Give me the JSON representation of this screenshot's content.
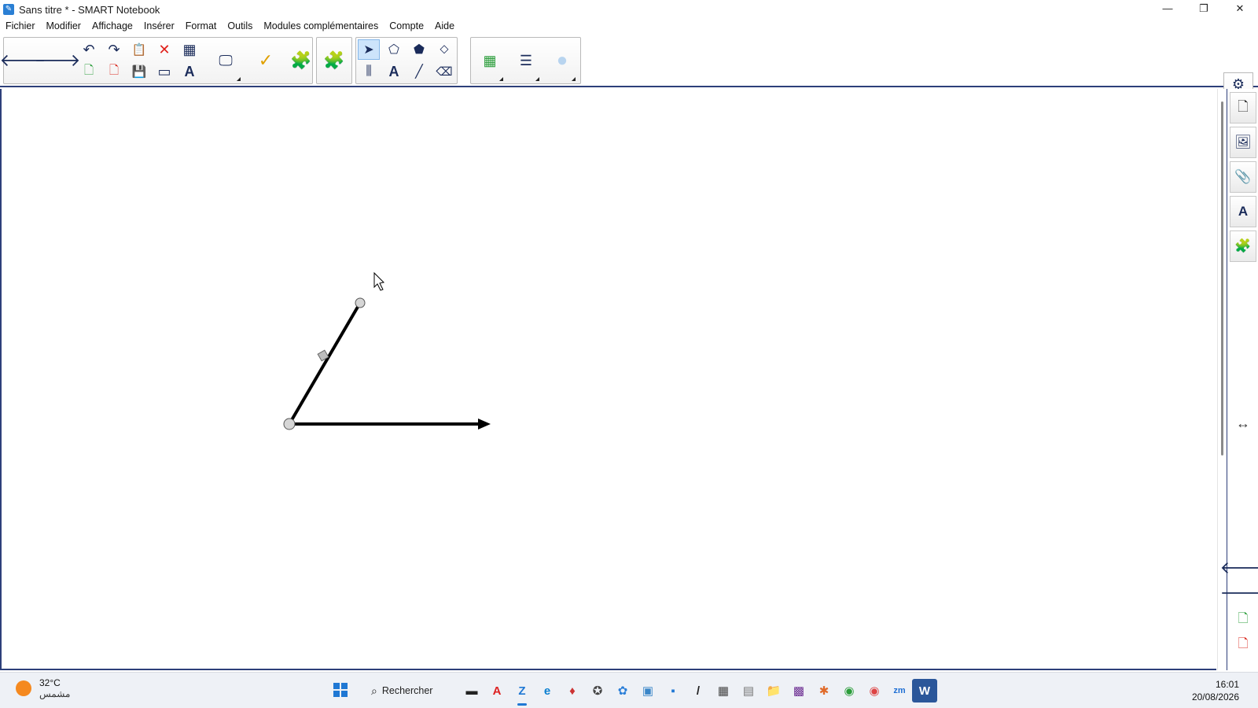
{
  "window": {
    "title": "Sans titre * - SMART Notebook",
    "minimize": "—",
    "maximize": "❐",
    "close": "✕"
  },
  "menu": [
    "Fichier",
    "Modifier",
    "Affichage",
    "Insérer",
    "Format",
    "Outils",
    "Modules complémentaires",
    "Compte",
    "Aide"
  ],
  "toolbar": {
    "back": "🡐",
    "forward": "🡒",
    "undo": "↶",
    "redo": "↷",
    "paste": "📋",
    "delete": "✕",
    "table": "▦",
    "add_page": "🗋",
    "delete_page": "🗋",
    "save": "💾",
    "screen_shade": "▭",
    "text_recognition": "A",
    "screen_capture": "🖵",
    "response": "✓",
    "addons": "🧩",
    "lab": "🧩",
    "select": "➤",
    "shapes": "⬠",
    "polygon": "⬟",
    "fill": "⬦",
    "magic_pen": "⫼",
    "text": "A",
    "line": "╱",
    "eraser": "⌫",
    "color_grid": "▦",
    "line_style": "☰",
    "fill_effect": "●"
  },
  "side_top": {
    "settings": "⚙",
    "move_toolbar": "⇕"
  },
  "sidebar": {
    "page_sorter": "🗋",
    "gallery": "🖼",
    "attachments": "📎",
    "properties": "A",
    "addons": "🧩",
    "resize": "↔",
    "prev_page": "🡐",
    "next_page": "🡒",
    "add_page": "🗋",
    "delete_page": "🗋"
  },
  "taskbar": {
    "temperature": "32°C",
    "weather_desc": "مشمس",
    "search_label": "Rechercher",
    "time": "16:01",
    "date": "20/08/2026",
    "apps": [
      "▬",
      "A",
      "Z",
      "e",
      "♦",
      "✪",
      "✿",
      "▣",
      "▪",
      "/",
      "▦",
      "▤",
      "📁",
      "▩",
      "✱",
      "◉",
      "◉",
      "zm",
      "W"
    ]
  }
}
